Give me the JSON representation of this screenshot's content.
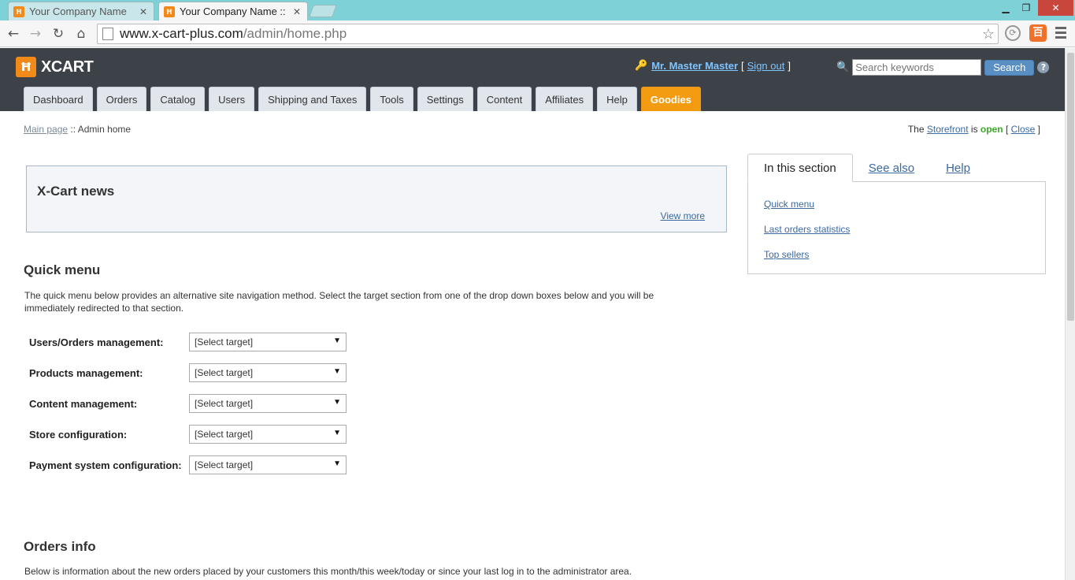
{
  "browser": {
    "tabs": [
      {
        "title": "Your Company Name",
        "active": false
      },
      {
        "title": "Your Company Name ::",
        "active": true
      }
    ],
    "url_host": "www.x-cart-plus.com",
    "url_path": "/admin/home.php"
  },
  "header": {
    "logo_text": "XCART",
    "user_name": "Mr. Master Master",
    "sign_out": "Sign out",
    "search_placeholder": "Search keywords",
    "search_button": "Search",
    "help": "?"
  },
  "nav": {
    "tabs": [
      "Dashboard",
      "Orders",
      "Catalog",
      "Users",
      "Shipping and Taxes",
      "Tools",
      "Settings",
      "Content",
      "Affiliates",
      "Help",
      "Goodies"
    ]
  },
  "breadcrumb": {
    "main_page": "Main page",
    "separator": "::",
    "current": "Admin home"
  },
  "storefront": {
    "prefix": "The",
    "link": "Storefront",
    "is": "is",
    "status": "open",
    "close": "Close"
  },
  "news": {
    "title": "X-Cart news",
    "view_more": "View more"
  },
  "quick_menu": {
    "title": "Quick menu",
    "description": "The quick menu below provides an alternative site navigation method. Select the target section from one of the drop down boxes below and you will be immediately redirected to that section.",
    "rows": [
      {
        "label": "Users/Orders management:",
        "value": "[Select target]"
      },
      {
        "label": "Products management:",
        "value": "[Select target]"
      },
      {
        "label": "Content management:",
        "value": "[Select target]"
      },
      {
        "label": "Store configuration:",
        "value": "[Select target]"
      },
      {
        "label": "Payment system configuration:",
        "value": "[Select target]"
      }
    ]
  },
  "orders_info": {
    "title": "Orders info",
    "description": "Below is information about the new orders placed by your customers this month/this week/today or since your last log in to the administrator area."
  },
  "side_panel": {
    "tabs": [
      "In this section",
      "See also",
      "Help"
    ],
    "links": [
      "Quick menu",
      "Last orders statistics",
      "Top sellers"
    ]
  },
  "colors": {
    "header_bg": "#3d4148",
    "accent_orange": "#f39c12",
    "link_blue": "#3c6aa0",
    "open_green": "#3caa28"
  }
}
